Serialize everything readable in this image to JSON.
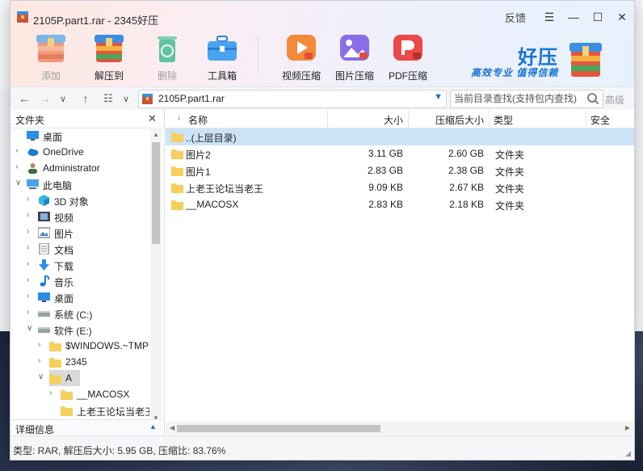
{
  "window": {
    "title": "2105P.part1.rar - 2345好压",
    "feedback": "反馈",
    "menu_glyph": "☰",
    "minimize_glyph": "—",
    "maximize_glyph": "☐",
    "close_glyph": "✕"
  },
  "toolbar": {
    "add": "添加",
    "extract": "解压到",
    "delete": "删除",
    "toolbox": "工具箱",
    "video_compress": "视频压缩",
    "image_compress": "图片压缩",
    "pdf_compress": "PDF压缩"
  },
  "brand": {
    "name": "好压",
    "slogan": "高效专业 值得信赖"
  },
  "nav": {
    "back": "←",
    "forward": "→",
    "dropdown": "∨",
    "up": "↑",
    "view": "☷",
    "view_dropdown": "∨",
    "path": "2105P.part1.rar",
    "path_dropdown": "▼",
    "search_placeholder": "当前目录查找(支持包内查找)",
    "advanced": "高级"
  },
  "tree": {
    "title": "文件夹",
    "close": "✕",
    "nodes": [
      {
        "label": "桌面",
        "icon": "desktop-icon",
        "depth": 0,
        "chevron": ""
      },
      {
        "label": "OneDrive",
        "icon": "cloud-icon",
        "depth": 0,
        "chevron": "›"
      },
      {
        "label": "Administrator",
        "icon": "user-icon",
        "depth": 0,
        "chevron": "›"
      },
      {
        "label": "此电脑",
        "icon": "computer-icon",
        "depth": 0,
        "chevron": "∨"
      },
      {
        "label": "3D 对象",
        "icon": "cube-icon",
        "depth": 1,
        "chevron": "›"
      },
      {
        "label": "视频",
        "icon": "video-icon",
        "depth": 1,
        "chevron": "›"
      },
      {
        "label": "图片",
        "icon": "picture-icon",
        "depth": 1,
        "chevron": "›"
      },
      {
        "label": "文档",
        "icon": "document-icon",
        "depth": 1,
        "chevron": "›"
      },
      {
        "label": "下载",
        "icon": "download-icon",
        "depth": 1,
        "chevron": "›"
      },
      {
        "label": "音乐",
        "icon": "music-icon",
        "depth": 1,
        "chevron": "›"
      },
      {
        "label": "桌面",
        "icon": "desktop-icon",
        "depth": 1,
        "chevron": "›"
      },
      {
        "label": "系统 (C:)",
        "icon": "drive-icon",
        "depth": 1,
        "chevron": "›"
      },
      {
        "label": "软件 (E:)",
        "icon": "drive-icon",
        "depth": 1,
        "chevron": "∨"
      },
      {
        "label": "$WINDOWS.~TMP",
        "icon": "folder-icon",
        "depth": 2,
        "chevron": "›"
      },
      {
        "label": "2345",
        "icon": "folder-icon",
        "depth": 2,
        "chevron": "›"
      },
      {
        "label": "A",
        "icon": "folder-icon",
        "depth": 2,
        "chevron": "∨",
        "selected": true
      },
      {
        "label": "__MACOSX",
        "icon": "folder-icon",
        "depth": 3,
        "chevron": "›"
      },
      {
        "label": "上老王论坛当老王",
        "icon": "folder-icon",
        "depth": 3,
        "chevron": ""
      }
    ],
    "scroll_up": "▲",
    "scroll_down": "▼"
  },
  "detail": {
    "label": "详细信息",
    "arrow": "▲"
  },
  "list": {
    "sort_arrow": "↓",
    "columns": [
      "名称",
      "大小",
      "压缩后大小",
      "类型",
      "安全"
    ],
    "rows": [
      {
        "name": "..(上层目录)",
        "size": "",
        "packed": "",
        "type": "",
        "selected": true
      },
      {
        "name": "图片2",
        "size": "3.11 GB",
        "packed": "2.60 GB",
        "type": "文件夹"
      },
      {
        "name": "图片1",
        "size": "2.83 GB",
        "packed": "2.38 GB",
        "type": "文件夹"
      },
      {
        "name": "上老王论坛当老王",
        "size": "9.09 KB",
        "packed": "2.67 KB",
        "type": "文件夹"
      },
      {
        "name": "__MACOSX",
        "size": "2.83 KB",
        "packed": "2.18 KB",
        "type": "文件夹"
      }
    ],
    "scroll_left": "◀",
    "scroll_right": "▶"
  },
  "status": {
    "text": "类型: RAR, 解压后大小: 5.95 GB, 压缩比: 83.76%",
    "grip": "◢"
  },
  "colors": {
    "accent": "#1874d6",
    "folder": "#f7cf5e",
    "selection": "#cce4f7"
  }
}
